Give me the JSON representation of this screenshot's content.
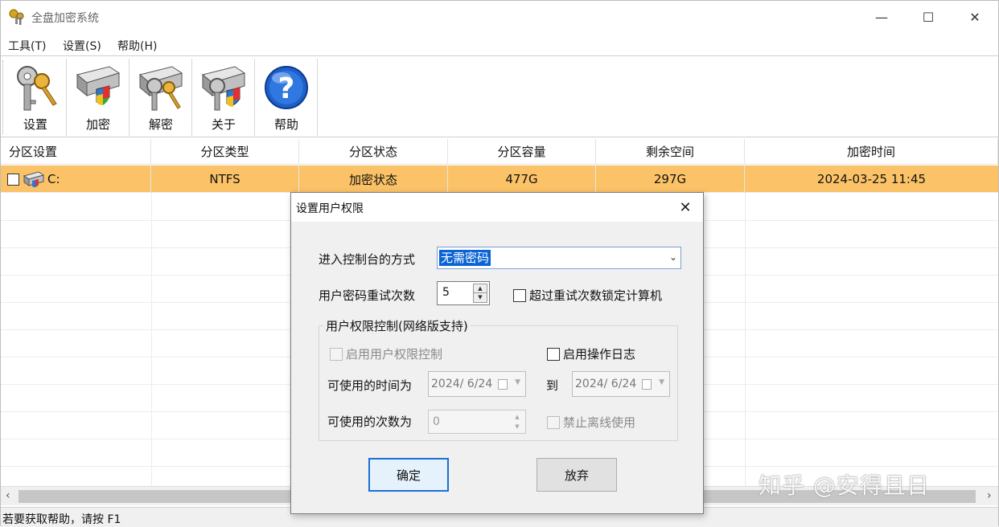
{
  "window": {
    "title": "全盘加密系统",
    "minimize": "—",
    "maximize": "☐",
    "close": "✕"
  },
  "menu": [
    {
      "label": "工具(T)"
    },
    {
      "label": "设置(S)"
    },
    {
      "label": "帮助(H)"
    }
  ],
  "toolbar": [
    {
      "label": "设置",
      "icon": "key-settings-icon"
    },
    {
      "label": "加密",
      "icon": "drive-shield-icon"
    },
    {
      "label": "解密",
      "icon": "drive-key-icon"
    },
    {
      "label": "关于",
      "icon": "drive-key-shield-icon"
    },
    {
      "label": "帮助",
      "icon": "help-question-icon"
    }
  ],
  "table": {
    "columns": [
      "分区设置",
      "分区类型",
      "分区状态",
      "分区容量",
      "剩余空间",
      "加密时间"
    ],
    "rows": [
      {
        "partition": "C:",
        "type": "NTFS",
        "status": "加密状态",
        "capacity": "477G",
        "free": "297G",
        "time": "2024-03-25 11:45"
      }
    ]
  },
  "status_bar": {
    "text": "若要获取帮助，请按 F1"
  },
  "watermark": "知乎 @安得且日",
  "dialog": {
    "title": "设置用户权限",
    "close": "✕",
    "console_label": "进入控制台的方式",
    "console_value": "无需密码",
    "retry_label": "用户密码重试次数",
    "retry_value": "5",
    "lock_label": "超过重试次数锁定计算机",
    "group_title": "用户权限控制(网络版支持)",
    "enable_perm_label": "启用用户权限控制",
    "enable_log_label": "启用操作日志",
    "time_label": "可使用的时间为",
    "date_from": "2024/ 6/24",
    "to_label": "到",
    "date_to": "2024/ 6/24",
    "count_label": "可使用的次数为",
    "count_value": "0",
    "offline_label": "禁止离线使用",
    "ok_label": "确定",
    "cancel_label": "放弃"
  },
  "colors": {
    "selected_row": "#fbc267",
    "default_button_border": "#1a6fd6",
    "selection_highlight": "#0a64d6"
  }
}
